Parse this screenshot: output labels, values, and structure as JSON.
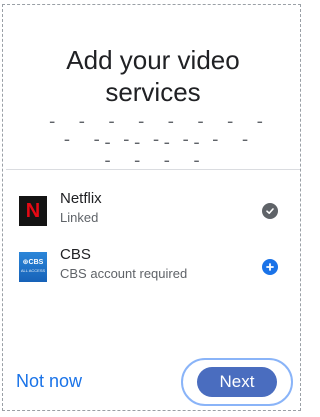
{
  "dialog": {
    "title_line1": "Add your video",
    "title_line2": "services",
    "dashes_line1": "- - - - - - - - - - - - - - -",
    "dashes_line2": "- - - - - - - -"
  },
  "services": [
    {
      "name": "Netflix",
      "status": "Linked",
      "logo_text": "N",
      "status_icon": "check-circle-icon"
    },
    {
      "name": "CBS",
      "status": "CBS account required",
      "logo_text": "⊛CBS",
      "logo_subtext": "ALL ACCESS",
      "status_icon": "add-circle-icon"
    }
  ],
  "actions": {
    "not_now": "Not now",
    "next": "Next"
  },
  "colors": {
    "accent": "#1a73e8",
    "next_button": "#4a6dbf",
    "focus_ring": "#8ab4f8",
    "netflix_red": "#e50914"
  }
}
